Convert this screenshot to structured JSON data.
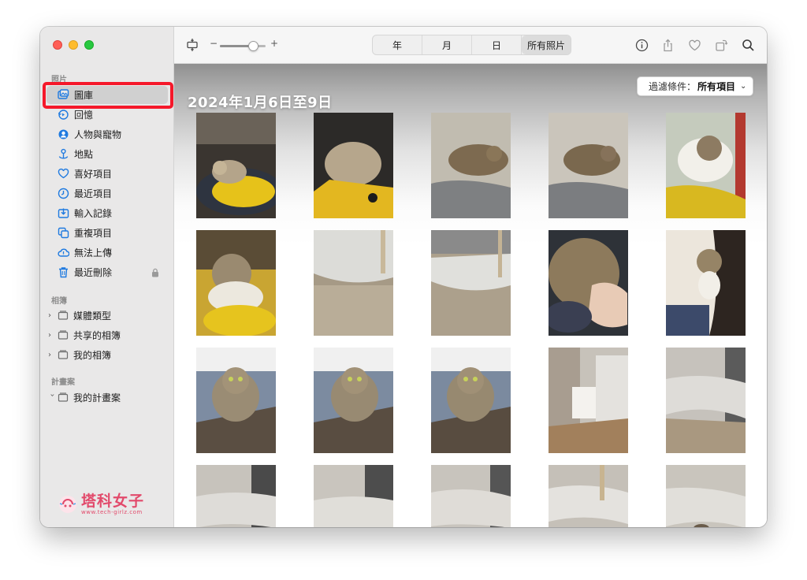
{
  "sidebar": {
    "sections": {
      "photos": "照片",
      "albums": "相簿",
      "projects": "計畫案"
    },
    "items": [
      {
        "label": "圖庫",
        "icon": "library-icon"
      },
      {
        "label": "回憶",
        "icon": "memories-icon"
      },
      {
        "label": "人物與寵物",
        "icon": "people-icon"
      },
      {
        "label": "地點",
        "icon": "places-icon"
      },
      {
        "label": "喜好項目",
        "icon": "heart-icon"
      },
      {
        "label": "最近項目",
        "icon": "clock-icon"
      },
      {
        "label": "輸入記錄",
        "icon": "import-icon"
      },
      {
        "label": "重複項目",
        "icon": "duplicate-icon"
      },
      {
        "label": "無法上傳",
        "icon": "cloud-icon"
      },
      {
        "label": "最近刪除",
        "icon": "trash-icon"
      }
    ],
    "albums": [
      {
        "label": "媒體類型"
      },
      {
        "label": "共享的相簿"
      },
      {
        "label": "我的相簿"
      }
    ],
    "projects": [
      {
        "label": "我的計畫案"
      }
    ],
    "logo": {
      "name": "塔科女子",
      "url": "www.tech-girlz.com"
    }
  },
  "toolbar": {
    "zoom_minus": "−",
    "zoom_plus": "+",
    "zoom_level": 0.72,
    "tabs": [
      "年",
      "月",
      "日",
      "所有照片"
    ],
    "active_tab": "所有照片"
  },
  "content": {
    "date_heading": "2024年1月6日至9日",
    "filter_prefix": "過濾條件：",
    "filter_value": "所有項目",
    "photo_count": 20
  },
  "colors": {
    "highlight": "#f5182a",
    "sidebar_bg": "#e9e8e8",
    "accent_icon": "#1f7ae0",
    "logo": "#e24a6b"
  }
}
